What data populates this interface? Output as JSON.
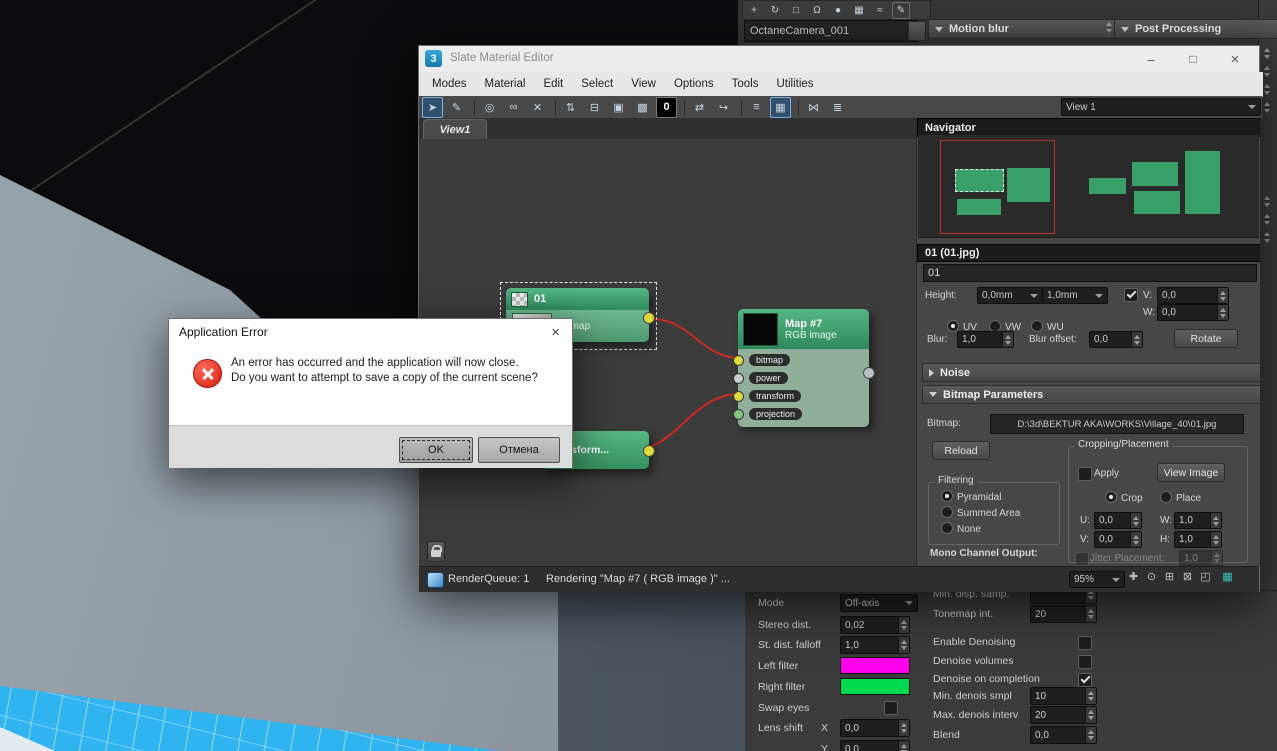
{
  "colors": {
    "node_green": "#3fa873",
    "wire_red": "#cf2c20",
    "connector_yellow": "#ddd83c",
    "viewport_blue": "#2fb4f0",
    "left_filter": "#ff00ee",
    "right_filter": "#00d94e",
    "navigator_view_red": "#c03131"
  },
  "bg": {
    "top_icons": [
      "+",
      "↻",
      "□",
      "Ω",
      "●",
      "▦",
      "≈",
      "✎"
    ],
    "camera_name": "OctaneCamera_001",
    "motion_blur": "Motion blur",
    "post_processing": "Post Processing",
    "left": {
      "mode_label": "Mode",
      "mode_value": "Off-axis",
      "stereo_label": "Stereo dist.",
      "stereo_value": "0,02",
      "falloff_label": "St. dist. falloff",
      "falloff_value": "1,0",
      "left_filter_label": "Left filter",
      "right_filter_label": "Right filter",
      "swap_label": "Swap eyes",
      "lens_label": "Lens shift",
      "lens_x": "X",
      "lens_x_value": "0,0",
      "lens_y": "Y",
      "lens_y_value": "0,0"
    },
    "right": {
      "min_disp_label": "Min. disp. samp.",
      "tonemap_label": "Tonemap int.",
      "tonemap_value": "20",
      "enable_label": "Enable Denoising",
      "volumes_label": "Denoise volumes",
      "completion_label": "Denoise on completion",
      "min_smpl_label": "Min. denois smpl",
      "min_smpl_value": "10",
      "max_interv_label": "Max. denois interv",
      "max_interv_value": "20",
      "blend_label": "Blend",
      "blend_value": "0,0"
    }
  },
  "editor": {
    "title": "Slate Material Editor",
    "logo": "3",
    "win_min": "–",
    "win_max": "□",
    "win_close": "×",
    "menu": [
      "Modes",
      "Material",
      "Edit",
      "Select",
      "View",
      "Options",
      "Tools",
      "Utilities"
    ],
    "toolbar_icons": [
      "➤",
      "✎",
      "◎",
      "∞",
      "✕",
      "⇅",
      "⊟",
      "▣",
      "▩",
      "0",
      "⇄",
      "↪",
      "≡",
      "▦",
      "⋈",
      "≣"
    ],
    "view_combo": "View 1",
    "view_tab": "View1",
    "nav": {
      "title": "Navigator",
      "close": "×"
    },
    "nodes": {
      "b01_title": "01",
      "b01_type": "Bitmap",
      "map7_title": "Map #7",
      "map7_type": "RGB image",
      "slots": [
        "bitmap",
        "power",
        "transform",
        "projection"
      ],
      "transform_title": "Transform..."
    },
    "panel": {
      "title": "01 (01.jpg)",
      "close": "×",
      "name_value": "01",
      "height_label": "Height:",
      "height_a": "0,0mm",
      "height_b": "1,0mm",
      "v_label": "V:",
      "v_value": "0,0",
      "w_label": "W:",
      "w_value": "0,0",
      "uv": "UV",
      "vw": "VW",
      "wu": "WU",
      "blur_label": "Blur:",
      "blur_value": "1,0",
      "blur_offset_label": "Blur offset:",
      "blur_offset_value": "0,0",
      "rotate": "Rotate"
    },
    "noise_title": "Noise",
    "bp": {
      "title": "Bitmap Parameters",
      "bitmap_label": "Bitmap:",
      "path": "D:\\3d\\BEKTUR AKA\\WORKS\\Village_40\\01.jpg",
      "reload": "Reload",
      "crop_group": "Cropping/Placement",
      "apply": "Apply",
      "view_image": "View Image",
      "crop": "Crop",
      "place": "Place",
      "u_label": "U:",
      "u_value": "0,0",
      "w_label": "W:",
      "w_value": "1,0",
      "v_label": "V:",
      "v_value": "0,0",
      "h_label": "H:",
      "h_value": "1,0",
      "jitter_label": "Jitter Placement:",
      "jitter_value": "1,0",
      "filtering_group": "Filtering",
      "filter_opts": [
        "Pyramidal",
        "Summed Area",
        "None"
      ],
      "mono_label": "Mono Channel Output:"
    },
    "status": {
      "queue": "RenderQueue: 1",
      "rendering": "Rendering \"Map #7  ( RGB image )\" ...",
      "zoom": "95%"
    },
    "status_icons": [
      "✚",
      "⊙",
      "⊞",
      "⊠",
      "◰",
      "▦"
    ]
  },
  "dialog": {
    "title": "Application Error",
    "close": "×",
    "line1": "An error has occurred and the application will now close.",
    "line2": "Do you want to attempt to save a copy of the current scene?",
    "ok": "OK",
    "cancel": "Отмена"
  }
}
